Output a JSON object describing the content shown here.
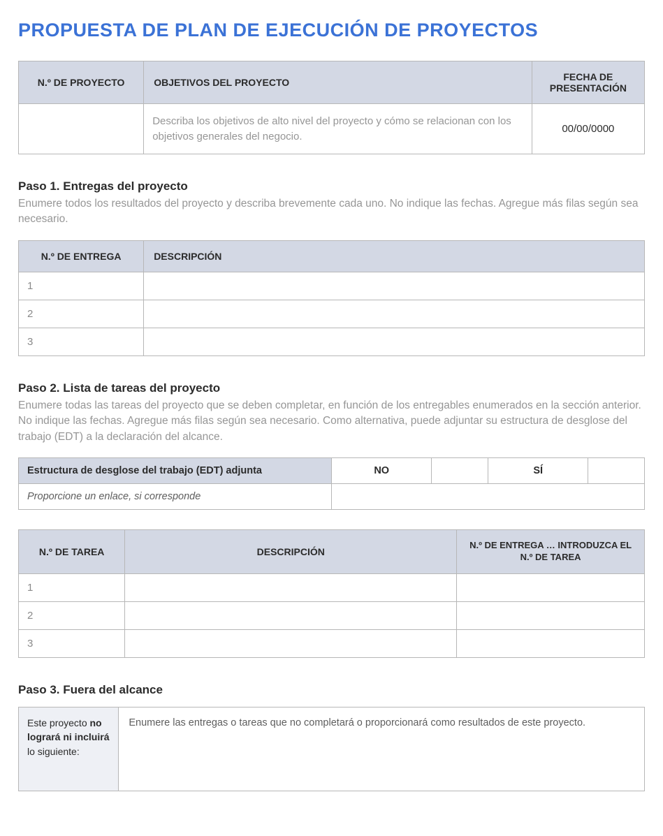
{
  "title": "PROPUESTA DE PLAN DE EJECUCIÓN DE PROYECTOS",
  "header_table": {
    "cols": [
      "N.º DE PROYECTO",
      "OBJETIVOS DEL PROYECTO",
      "FECHA DE PRESENTACIÓN"
    ],
    "project_no": "",
    "objectives_placeholder": "Describa los objetivos de alto nivel del proyecto y cómo se relacionan con los objetivos generales del negocio.",
    "date": "00/00/0000"
  },
  "step1": {
    "title": "Paso 1. Entregas del proyecto",
    "desc": "Enumere todos los resultados del proyecto y describa brevemente cada uno. No indique las fechas. Agregue más filas según sea necesario.",
    "cols": [
      "N.º DE ENTREGA",
      "DESCRIPCIÓN"
    ],
    "rows": [
      {
        "num": "1",
        "desc": ""
      },
      {
        "num": "2",
        "desc": ""
      },
      {
        "num": "3",
        "desc": ""
      }
    ]
  },
  "step2": {
    "title": "Paso 2. Lista de tareas del proyecto",
    "desc": "Enumere todas las tareas del proyecto que se deben completar, en función de los entregables enumerados en la sección anterior. No indique las fechas. Agregue más filas según sea necesario. Como alternativa, puede adjuntar su estructura de desglose del trabajo (EDT) a la declaración del alcance.",
    "edt": {
      "label": "Estructura de desglose del trabajo (EDT) adjunta",
      "no": "NO",
      "si": "SÍ",
      "no_val": "",
      "si_val": "",
      "link_label": "Proporcione un enlace, si corresponde",
      "link_val": ""
    },
    "cols": [
      "N.º DE TAREA",
      "DESCRIPCIÓN",
      "N.º DE ENTREGA … INTRODUZCA EL N.º DE TAREA"
    ],
    "rows": [
      {
        "num": "1",
        "desc": "",
        "deliv": ""
      },
      {
        "num": "2",
        "desc": "",
        "deliv": ""
      },
      {
        "num": "3",
        "desc": "",
        "deliv": ""
      }
    ]
  },
  "step3": {
    "title": "Paso 3. Fuera del alcance",
    "label_pre": "Este proyecto ",
    "label_bold": "no logrará ni incluirá",
    "label_post": " lo siguiente:",
    "body": "Enumere las entregas o tareas que no completará o proporcionará como resultados de este proyecto."
  }
}
